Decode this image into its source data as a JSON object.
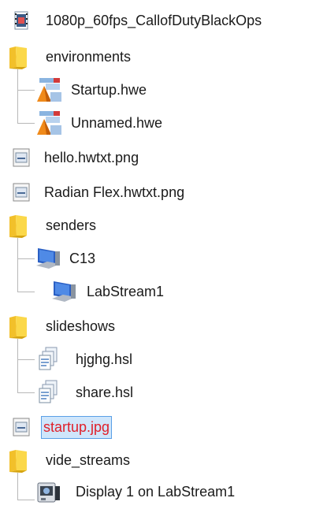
{
  "tree": {
    "items": [
      {
        "label": "1080p_60fps_CallofDutyBlackOps",
        "icon": "video-file-icon"
      },
      {
        "label": "environments",
        "icon": "folder-icon"
      },
      {
        "label": "Startup.hwe",
        "icon": "environment-file-icon"
      },
      {
        "label": "Unnamed.hwe",
        "icon": "environment-file-icon"
      },
      {
        "label": "hello.hwtxt.png",
        "icon": "image-file-icon"
      },
      {
        "label": "Radian Flex.hwtxt.png",
        "icon": "image-file-icon"
      },
      {
        "label": "senders",
        "icon": "folder-icon"
      },
      {
        "label": "C13",
        "icon": "computer-icon"
      },
      {
        "label": "LabStream1",
        "icon": "computer-icon"
      },
      {
        "label": "slideshows",
        "icon": "folder-icon"
      },
      {
        "label": "hjghg.hsl",
        "icon": "slideshow-file-icon"
      },
      {
        "label": "share.hsl",
        "icon": "slideshow-file-icon"
      },
      {
        "label": "startup.jpg",
        "icon": "image-file-icon",
        "selected": true
      },
      {
        "label": "vide_streams",
        "icon": "folder-icon"
      },
      {
        "label": "Display 1 on LabStream1",
        "icon": "capture-device-icon"
      }
    ]
  },
  "colors": {
    "text": "#1a1a1a",
    "selected_text": "#e0202a",
    "selected_bg": "#cfe6fb",
    "selected_border": "#5aa0e6",
    "folder": "#f5c518",
    "connector": "#b8b8b8"
  }
}
